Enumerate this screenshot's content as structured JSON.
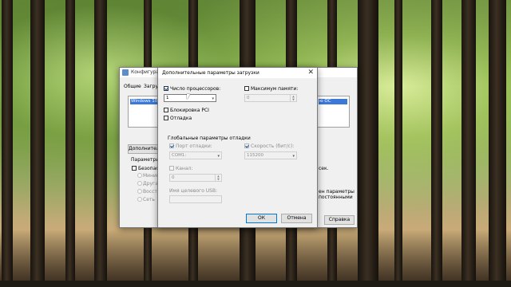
{
  "back_window": {
    "title": "Конфигура",
    "tabs": [
      "Общие",
      "Загрузк"
    ],
    "boot_list_item": "Windows 10 (",
    "boot_list_right_item": "ю ОС",
    "advanced_button": "Дополнител",
    "boot_params_label": "Параметры з",
    "safe_mode_label": "Безопасн",
    "radio_options": [
      "Минима",
      "Другая",
      "Восста",
      "Сеть"
    ],
    "timeout_suffix": "сек.",
    "persist_text": [
      "ен параметры",
      "постоянными"
    ],
    "help_button": "Справка"
  },
  "dialog": {
    "title": "Дополнительные параметры загрузки",
    "close_glyph": "✕",
    "cpu_count_label": "Число процессоров:",
    "cpu_count_checked": true,
    "cpu_count_value": "1",
    "max_memory_label": "Максимум памяти:",
    "max_memory_checked": false,
    "max_memory_value": "0",
    "pci_lock_label": "Блокировка PCI",
    "debug_label": "Отладка",
    "global_debug_label": "Глобальные параметры отладки",
    "debug_port_label": "Порт отладки:",
    "debug_port_value": "COM1:",
    "baud_rate_label": "Скорость (бит/с):",
    "baud_rate_value": "115200",
    "channel_label": "Канал:",
    "channel_value": "0",
    "usb_target_label": "Имя целевого USB:",
    "ok_label": "ОК",
    "cancel_label": "Отмена"
  }
}
